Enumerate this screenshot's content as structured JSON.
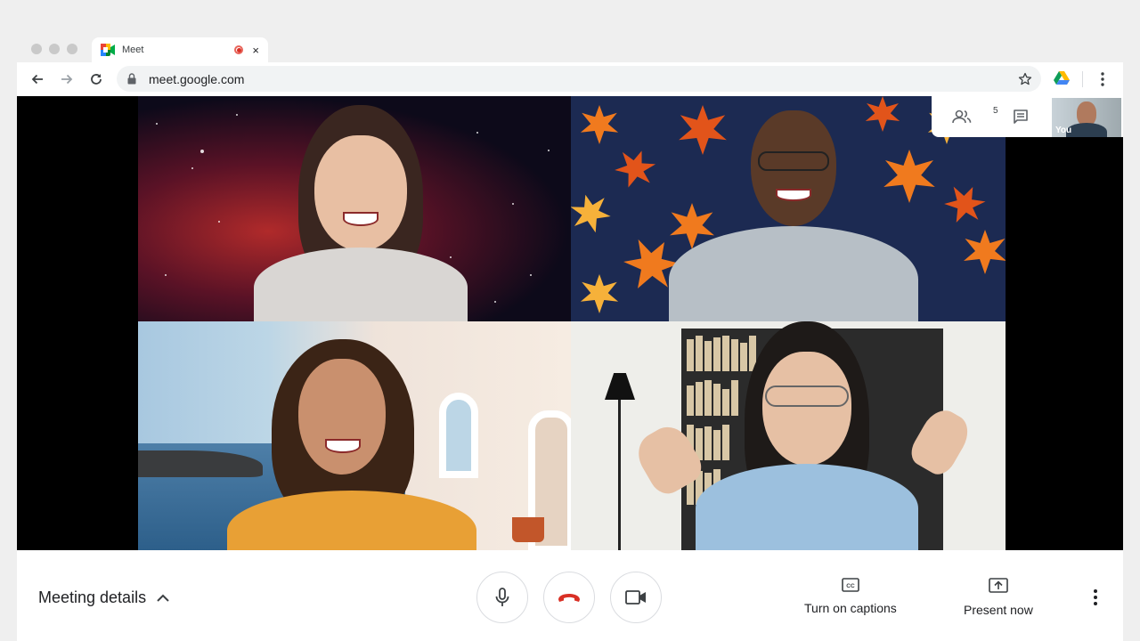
{
  "browser": {
    "tab_title": "Meet",
    "tab_close": "×",
    "url": "meet.google.com"
  },
  "meeting": {
    "participant_count": "5",
    "self_label": "You",
    "details_label": "Meeting details",
    "captions_label": "Turn on captions",
    "present_label": "Present now"
  },
  "colors": {
    "end_call_red": "#d93025",
    "icon_gray": "#5f6368",
    "chrome_bg": "#efefef"
  },
  "icons": {
    "back": "arrow-left-icon",
    "forward": "arrow-right-icon",
    "reload": "reload-icon",
    "lock": "lock-icon",
    "bookmark": "star-icon",
    "drive": "google-drive-icon",
    "menu": "vertical-dots-icon",
    "people": "people-icon",
    "chat": "chat-icon",
    "mic": "microphone-icon",
    "hangup": "phone-hangup-icon",
    "camera": "video-camera-icon",
    "captions": "closed-captions-icon",
    "present": "present-screen-icon"
  }
}
